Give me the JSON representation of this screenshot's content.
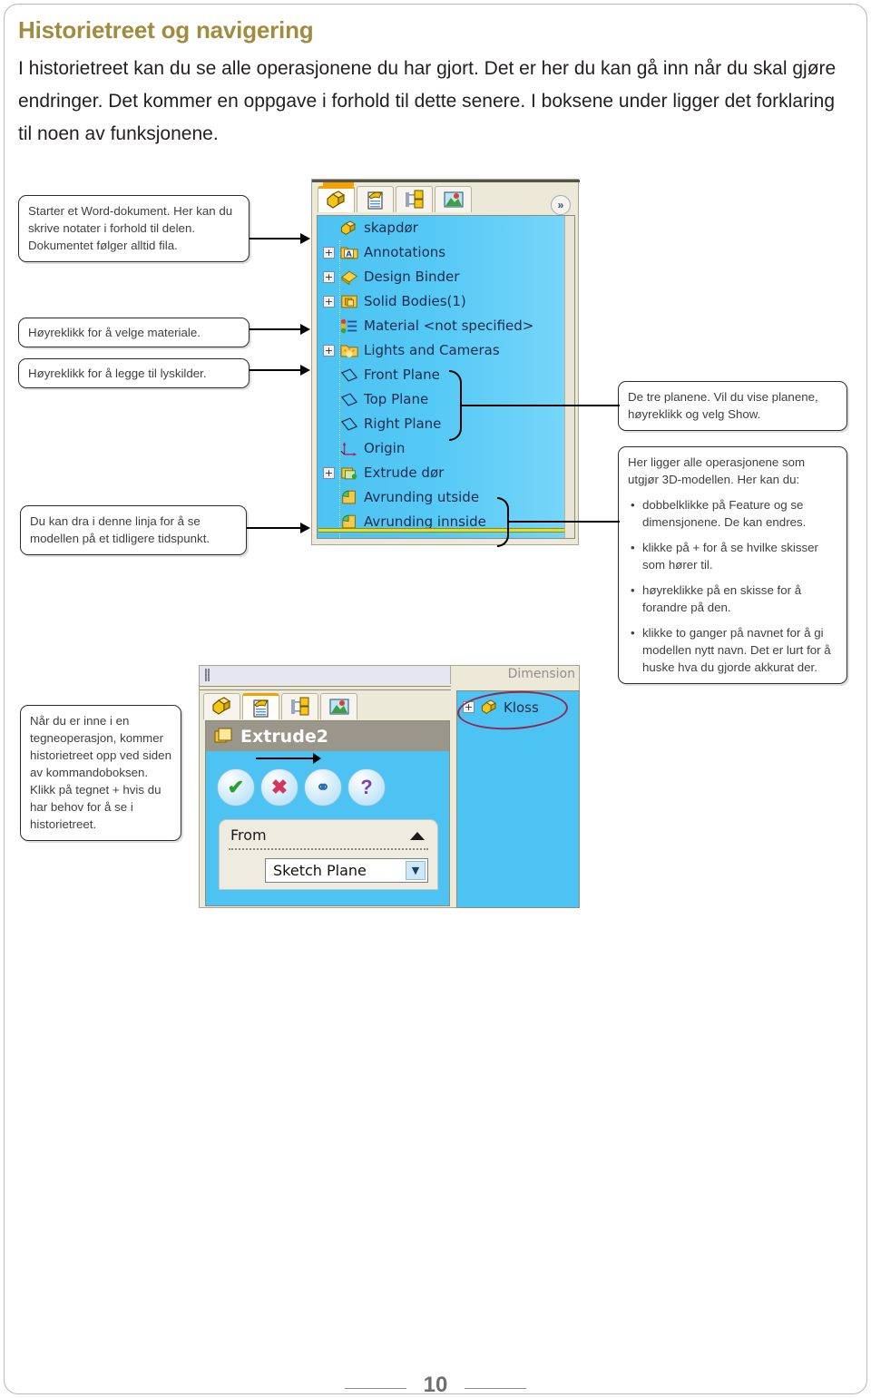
{
  "page": {
    "title": "Historietreet og navigering",
    "intro": "I historietreet kan du se alle operasjonene du har gjort. Det er her du kan gå inn når du skal gjøre endringer. Det kommer en oppgave i forhold til dette senere. I boksene under ligger det forklaring til noen av funksjonene.",
    "number": "10",
    "title_color": "#a08b3f"
  },
  "callouts": {
    "word_doc": "Starter et Word-dokument. Her kan du skrive notater i forhold til delen. Dokumentet følger alltid fila.",
    "material": "Høyreklikk for å velge materiale.",
    "lights": "Høyreklikk for å legge til lyskilder.",
    "rollback": "Du kan dra i denne linja for å se modellen på et tidligere tidspunkt.",
    "sketchmode": "Når du er inne i en tegneoperasjon, kommer historietreet opp ved siden av kommandoboksen. Klikk på tegnet + hvis du har behov for å se i historietreet.",
    "planes": "De tre planene. Vil du vise planene, høyreklikk og velg Show.",
    "features": {
      "lead": "Her ligger alle operasjonene som utgjør 3D-modellen. Her kan du:",
      "bullets": [
        "dobbelklikke på Feature og se dimensjonene. De kan endres.",
        "klikke på + for å se hvilke skisser som hører til.",
        "høyreklikke på en skisse for å forandre på den.",
        "klikke to ganger på navnet for å gi modellen nytt navn. Det er lurt for å huske hva du gjorde akkurat der."
      ]
    }
  },
  "solidworks_tree": {
    "tabs": [
      {
        "name": "feature-manager-tab",
        "icon": "feature-tree-icon",
        "active": true
      },
      {
        "name": "property-manager-tab",
        "icon": "property-clipboard-icon",
        "active": false
      },
      {
        "name": "configuration-manager-tab",
        "icon": "configuration-icon",
        "active": false
      },
      {
        "name": "display-manager-tab",
        "icon": "display-image-icon",
        "active": false
      }
    ],
    "expand_button": "»",
    "items": [
      {
        "label": "skapdør",
        "plus": false,
        "icon": "part-icon",
        "level": 0
      },
      {
        "label": "Annotations",
        "plus": true,
        "icon": "annotations-icon",
        "level": 1
      },
      {
        "label": "Design Binder",
        "plus": true,
        "icon": "binder-icon",
        "level": 1
      },
      {
        "label": "Solid Bodies(1)",
        "plus": true,
        "icon": "solidbody-icon",
        "level": 1
      },
      {
        "label": "Material <not specified>",
        "plus": false,
        "icon": "material-icon",
        "level": 1
      },
      {
        "label": "Lights and Cameras",
        "plus": true,
        "icon": "lights-icon",
        "level": 1
      },
      {
        "label": "Front Plane",
        "plus": false,
        "icon": "plane-icon",
        "level": 1
      },
      {
        "label": "Top Plane",
        "plus": false,
        "icon": "plane-icon",
        "level": 1
      },
      {
        "label": "Right Plane",
        "plus": false,
        "icon": "plane-icon",
        "level": 1
      },
      {
        "label": "Origin",
        "plus": false,
        "icon": "origin-icon",
        "level": 1
      },
      {
        "label": "Extrude dør",
        "plus": true,
        "icon": "extrude-icon",
        "level": 1
      },
      {
        "label": "Avrunding utside",
        "plus": false,
        "icon": "fillet-icon",
        "level": 1
      },
      {
        "label": "Avrunding innside",
        "plus": false,
        "icon": "fillet-icon",
        "level": 1
      }
    ],
    "rollback_bar": "rollback-bar"
  },
  "solidworks_sketch": {
    "dimension_label": "Dimension",
    "property_title": "Extrude2",
    "buttons": [
      {
        "name": "ok-button",
        "glyph": "✔",
        "color": "#2e9e34"
      },
      {
        "name": "cancel-button",
        "glyph": "✖",
        "color": "#d6355f"
      },
      {
        "name": "preview-button",
        "glyph": "⚭",
        "color": "#2a6fa8"
      },
      {
        "name": "help-button",
        "glyph": "?",
        "color": "#7a3fb5"
      }
    ],
    "from_label": "From",
    "from_value": "Sketch Plane",
    "model_item": "Kloss",
    "model_item_plus": "+",
    "highlight_color": "#8e2a52"
  }
}
